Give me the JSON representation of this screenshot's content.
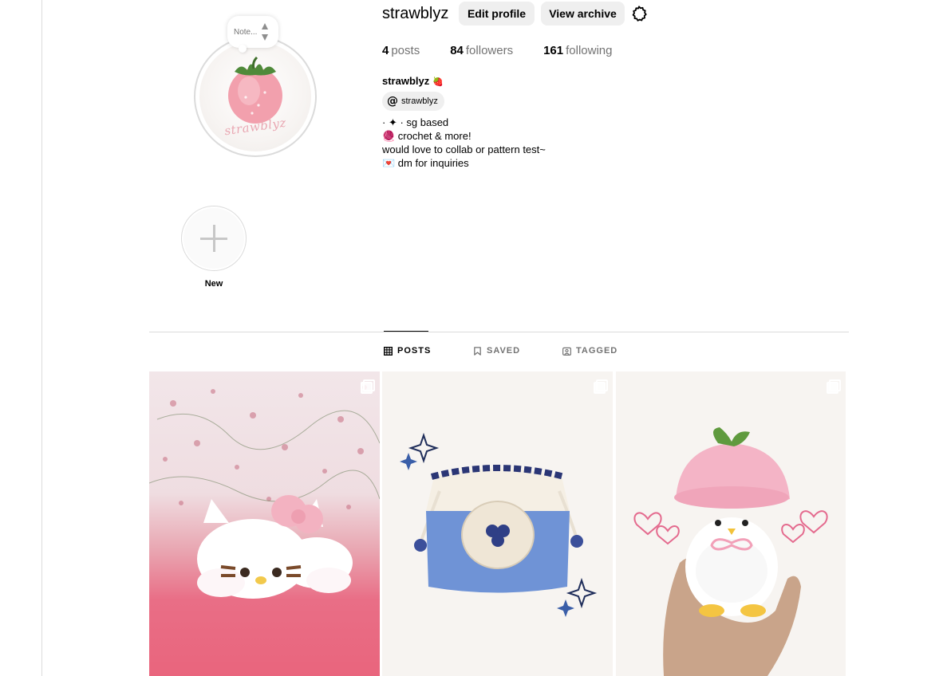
{
  "profile": {
    "username": "strawblyz",
    "avatar_text": "strawblyz",
    "note_placeholder": "Note...",
    "edit_profile_label": "Edit profile",
    "view_archive_label": "View archive",
    "stats": {
      "posts_count": "4",
      "posts_label": "posts",
      "followers_count": "84",
      "followers_label": "followers",
      "following_count": "161",
      "following_label": "following"
    },
    "display_name": "strawblyz",
    "display_name_emoji": "🍓",
    "threads_handle": "strawblyz",
    "bio_lines": [
      "· ✦ · sg based",
      "🧶 crochet & more!",
      "would love to collab or pattern test~",
      "💌  dm for inquiries"
    ]
  },
  "highlights": {
    "new_label": "New"
  },
  "tabs": [
    {
      "label": "POSTS",
      "icon": "grid-icon",
      "active": true
    },
    {
      "label": "SAVED",
      "icon": "bookmark-icon",
      "active": false
    },
    {
      "label": "TAGGED",
      "icon": "tagged-icon",
      "active": false
    }
  ],
  "posts": [
    {
      "subject": "crochet white cat plush with pink bow lying on pink blanket",
      "multi": true
    },
    {
      "subject": "crochet blue drawstring pouch with blueberry patch",
      "multi": true
    },
    {
      "subject": "crochet penguin with pink strawberry hat held in hand",
      "multi": true
    }
  ],
  "colors": {
    "accent_pink": "#f4a7b9",
    "button_bg": "#efefef",
    "muted_text": "#737373",
    "divider": "#dbdbdb"
  }
}
